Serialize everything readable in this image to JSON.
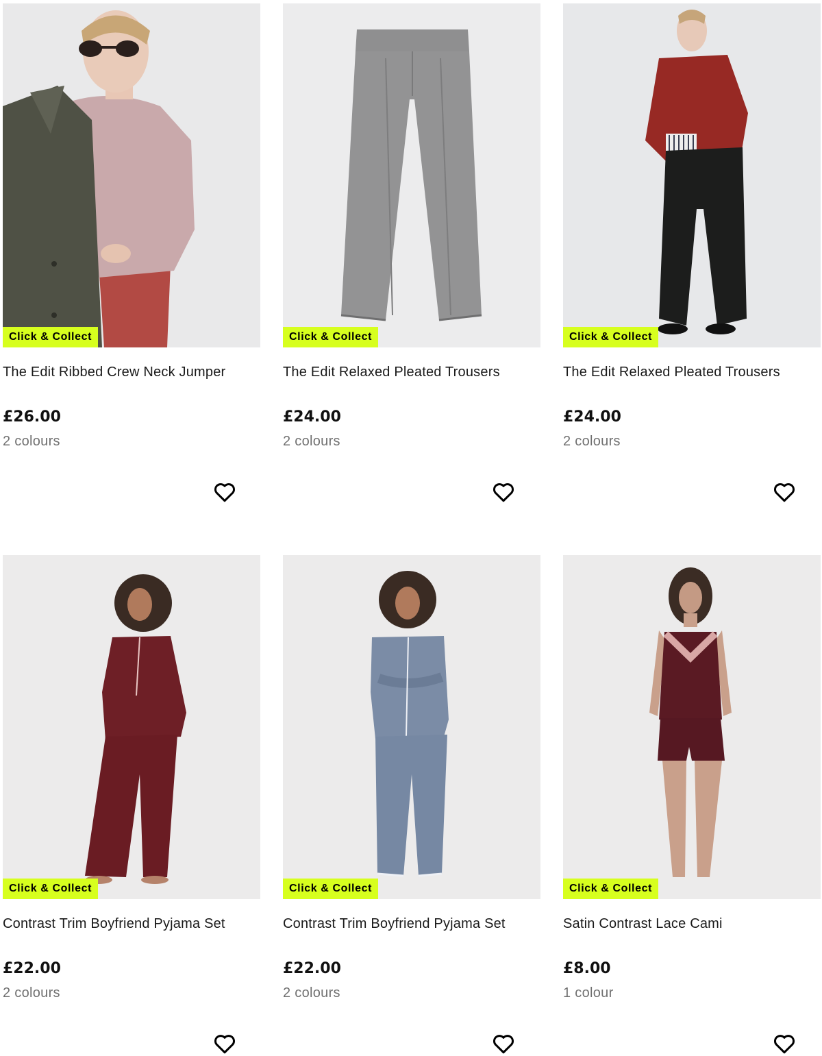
{
  "products": [
    {
      "badge": "Click & Collect",
      "title": "The Edit Ribbed Crew Neck Jumper",
      "price": "£26.00",
      "colours": "2 colours",
      "image_icon": "product-photo-jumper"
    },
    {
      "badge": "Click & Collect",
      "title": "The Edit Relaxed Pleated Trousers",
      "price": "£24.00",
      "colours": "2 colours",
      "image_icon": "product-photo-grey-trousers"
    },
    {
      "badge": "Click & Collect",
      "title": "The Edit Relaxed Pleated Trousers",
      "price": "£24.00",
      "colours": "2 colours",
      "image_icon": "product-photo-black-trousers"
    },
    {
      "badge": "Click & Collect",
      "title": "Contrast Trim Boyfriend Pyjama Set",
      "price": "£22.00",
      "colours": "2 colours",
      "image_icon": "product-photo-burgundy-pyjamas"
    },
    {
      "badge": "Click & Collect",
      "title": "Contrast Trim Boyfriend Pyjama Set",
      "price": "£22.00",
      "colours": "2 colours",
      "image_icon": "product-photo-blue-pyjamas"
    },
    {
      "badge": "Click & Collect",
      "title": "Satin Contrast Lace Cami",
      "price": "£8.00",
      "colours": "1 colour",
      "image_icon": "product-photo-lace-cami"
    }
  ],
  "colors": {
    "badge_bg": "#d7ff1e",
    "image_bg": "#ebebeb",
    "price": "#111111",
    "muted": "#707070"
  }
}
